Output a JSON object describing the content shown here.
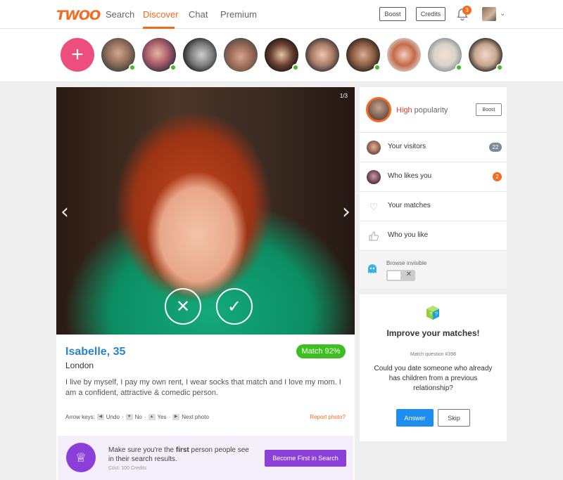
{
  "brand": {
    "logo": "TWOO",
    "accent": "#f26b21"
  },
  "nav": {
    "search": "Search",
    "discover": "Discover",
    "chat": "Chat",
    "premium": "Premium",
    "active": "Discover"
  },
  "header": {
    "boost_label": "Boost",
    "credits_label": "Credits",
    "notification_count": "3"
  },
  "stories": {
    "add_label": "+",
    "people": [
      {
        "online": true
      },
      {
        "online": true
      },
      {
        "online": false
      },
      {
        "online": false
      },
      {
        "online": true
      },
      {
        "online": false
      },
      {
        "online": true
      },
      {
        "online": false
      },
      {
        "online": true
      },
      {
        "online": false
      },
      {
        "online": true
      }
    ]
  },
  "profile": {
    "photo_counter": "1/3",
    "name_age": "Isabelle, 35",
    "city": "London",
    "match": "Match 92%",
    "bio": "I live by myself, I pay my own rent, I wear socks that match and I love my mom. I am a confident, attractive & comedic person.",
    "arrow_keys": {
      "label": "Arrow keys:",
      "undo": "Undo",
      "no": "No",
      "yes": "Yes",
      "next": "Next photo"
    },
    "report": "Report photo?"
  },
  "promo": {
    "text_pre": "Make sure you're the ",
    "text_bold": "first",
    "text_post": " person people see in their search results.",
    "cost": "Cost: 100 Credits",
    "button": "Become First in Search",
    "color": "#8b3fd9"
  },
  "popularity": {
    "level": "High",
    "suffix": " popularity",
    "boost": "Boost"
  },
  "menu": [
    {
      "label": "Your visitors",
      "badge": "22"
    },
    {
      "label": "Who likes you",
      "badge": "2"
    },
    {
      "label": "Your matches",
      "badge": ""
    },
    {
      "label": "Who you like",
      "badge": ""
    }
  ],
  "invisible": {
    "label": "Browse invisible",
    "enabled": false
  },
  "improve": {
    "title": "Improve your matches!",
    "question_num": "Match question #398",
    "question": "Could you date someone who already has children from a previous relationship?",
    "answer": "Answer",
    "skip": "Skip"
  }
}
